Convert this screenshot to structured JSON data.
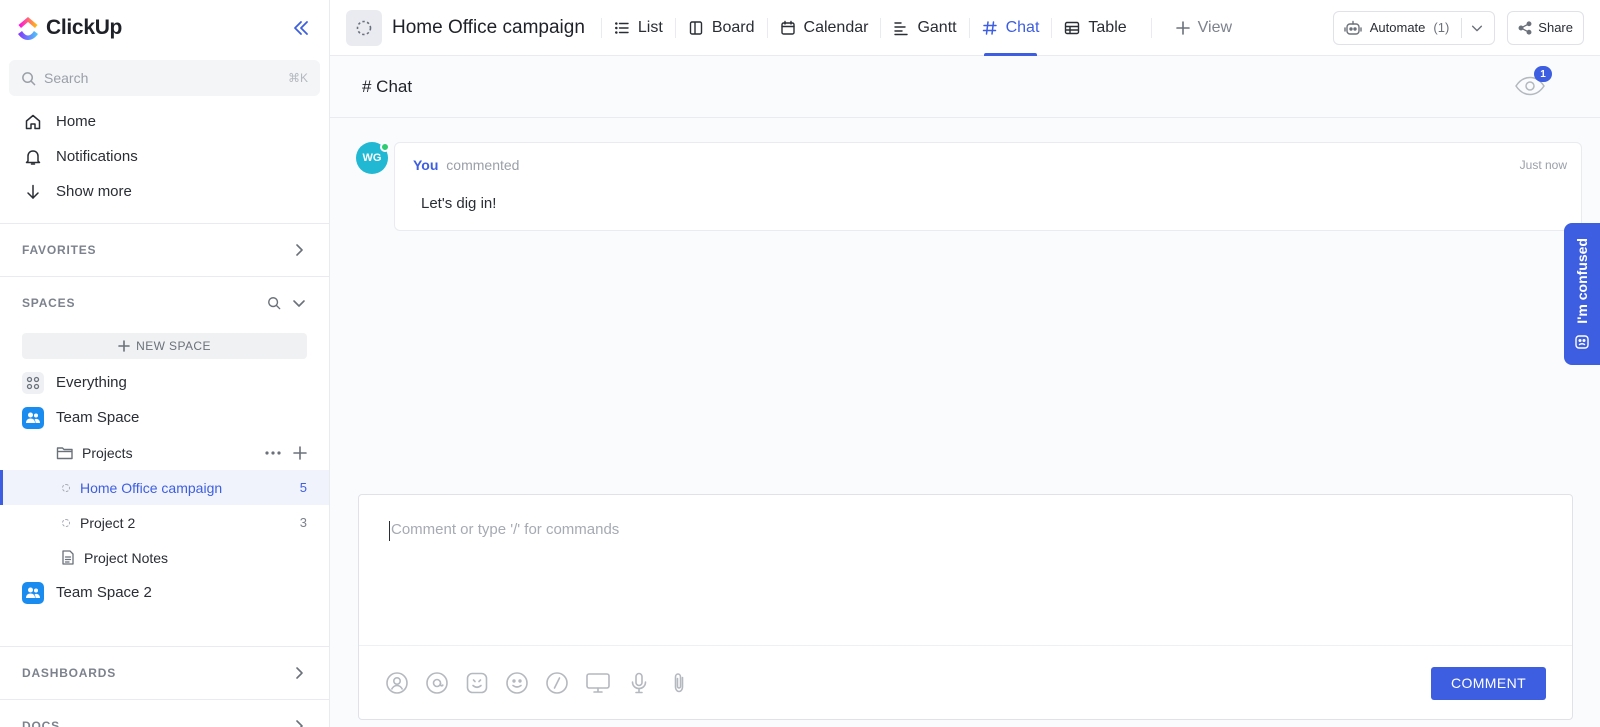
{
  "app": {
    "name": "ClickUp"
  },
  "sidebar": {
    "search_placeholder": "Search",
    "search_shortcut": "⌘K",
    "nav": [
      {
        "label": "Home",
        "icon": "home-icon"
      },
      {
        "label": "Notifications",
        "icon": "bell-icon"
      },
      {
        "label": "Show more",
        "icon": "arrow-down-icon"
      }
    ],
    "favorites_label": "FAVORITES",
    "spaces_label": "SPACES",
    "new_space_label": "NEW SPACE",
    "everything_label": "Everything",
    "team_space_label": "Team Space",
    "folder_label": "Projects",
    "lists": [
      {
        "label": "Home Office campaign",
        "count": "5",
        "active": true
      },
      {
        "label": "Project 2",
        "count": "3",
        "active": false
      }
    ],
    "doc_label": "Project Notes",
    "team_space_2_label": "Team Space 2",
    "dashboards_label": "DASHBOARDS",
    "docs_label": "DOCS"
  },
  "header": {
    "title": "Home Office campaign",
    "tabs": [
      {
        "label": "List",
        "icon": "list-icon"
      },
      {
        "label": "Board",
        "icon": "board-icon"
      },
      {
        "label": "Calendar",
        "icon": "calendar-icon"
      },
      {
        "label": "Gantt",
        "icon": "gantt-icon"
      },
      {
        "label": "Chat",
        "icon": "hash-icon",
        "active": true
      },
      {
        "label": "Table",
        "icon": "table-icon"
      }
    ],
    "add_view_label": "View",
    "automate_label": "Automate",
    "automate_count": "(1)",
    "share_label": "Share"
  },
  "chat": {
    "title": "# Chat",
    "watchers_count": "1",
    "comment": {
      "avatar_initials": "WG",
      "author": "You",
      "action": "commented",
      "time": "Just now",
      "text": "Let's dig in!"
    },
    "composer_placeholder": "Comment or type '/' for commands",
    "comment_button_label": "COMMENT"
  },
  "help_tab_label": "I'm confused",
  "colors": {
    "accent": "#3d5ee1",
    "team_space": "#1a8cf0",
    "avatar": "#21b8d4",
    "online": "#2ecc71"
  }
}
